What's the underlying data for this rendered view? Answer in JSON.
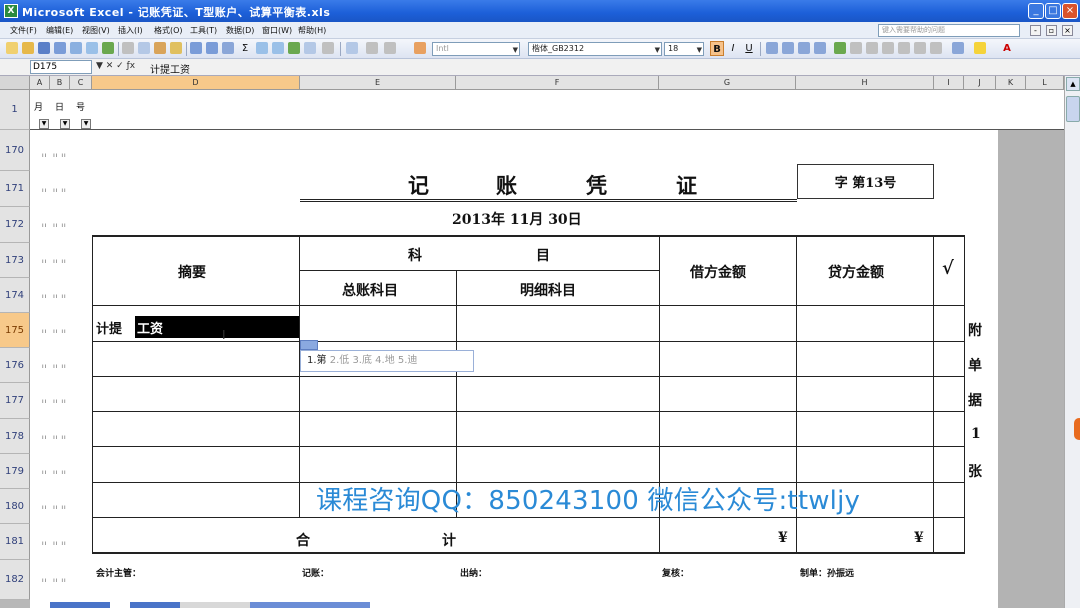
{
  "window": {
    "title": "Microsoft Excel - 记账凭证、T型账户、试算平衡表.xls",
    "app_icon": "excel-icon",
    "controls": [
      "minimize",
      "maximize",
      "close"
    ]
  },
  "menu": {
    "items": [
      "文件(F)",
      "编辑(E)",
      "视图(V)",
      "插入(I)",
      "格式(O)",
      "工具(T)",
      "数据(D)",
      "窗口(W)",
      "帮助(H)"
    ],
    "help_placeholder": "键入需要帮助的问题"
  },
  "toolbar": {
    "style_select": "Intl",
    "font_name": "楷体_GB2312",
    "font_size": "18",
    "bold": "B",
    "italic": "I",
    "underline": "U"
  },
  "formula_bar": {
    "name_box": "D175",
    "content": "计提工资"
  },
  "grid": {
    "columns": [
      "A",
      "B",
      "C",
      "D",
      "E",
      "F",
      "G",
      "H",
      "I",
      "J",
      "K",
      "L"
    ],
    "active_column": "D",
    "header_labels": [
      "月",
      "日",
      "号"
    ],
    "rows": [
      {
        "num": "1",
        "active": false
      },
      {
        "num": "170",
        "active": false
      },
      {
        "num": "171",
        "active": false
      },
      {
        "num": "172",
        "active": false
      },
      {
        "num": "173",
        "active": false
      },
      {
        "num": "174",
        "active": false
      },
      {
        "num": "175",
        "active": true
      },
      {
        "num": "176",
        "active": false
      },
      {
        "num": "177",
        "active": false
      },
      {
        "num": "178",
        "active": false
      },
      {
        "num": "179",
        "active": false
      },
      {
        "num": "180",
        "active": false
      },
      {
        "num": "181",
        "active": false
      },
      {
        "num": "182",
        "active": false
      }
    ]
  },
  "voucher": {
    "title_chars": [
      "记",
      "账",
      "凭",
      "证"
    ],
    "word_no": "字  第13号",
    "date": "2013年  11月  30日",
    "headers": {
      "summary": "摘要",
      "account": [
        "科",
        "目"
      ],
      "general_account": "总账科目",
      "detail_account": "明细科目",
      "debit": "借方金额",
      "credit": "贷方金额",
      "check": "√"
    },
    "entry_prefix": "计提",
    "entry_selected": "工资",
    "total_label": [
      "合",
      "计"
    ],
    "currency_debit": "¥",
    "currency_credit": "¥",
    "attachment": [
      "附",
      "单",
      "据",
      "1",
      "张"
    ],
    "footer": {
      "supervisor": "会计主管：",
      "bookkeeper": "记账：",
      "cashier": "出纳：",
      "reviewer": "复核：",
      "maker": "制单：孙振远"
    }
  },
  "ime": {
    "first": "1.第",
    "rest": " 2.低  3.底  4.地  5.迪"
  },
  "watermark": "课程咨询QQ：850243100   微信公众号:ttwljy"
}
